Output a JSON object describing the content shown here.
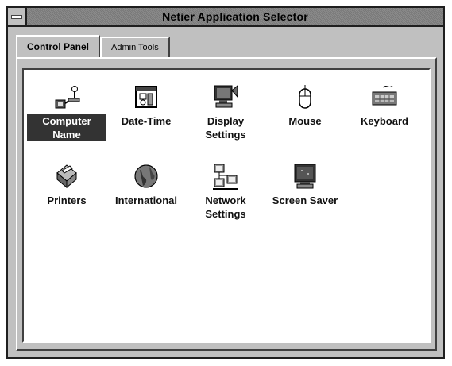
{
  "window": {
    "title": "Netier Application Selector"
  },
  "tabs": [
    {
      "label": "Control Panel",
      "active": true
    },
    {
      "label": "Admin Tools",
      "active": false
    }
  ],
  "items": [
    {
      "label": "Computer Name",
      "icon": "computer-name-icon",
      "selected": true
    },
    {
      "label": "Date-Time",
      "icon": "calendar-clock-icon"
    },
    {
      "label": "Display Settings",
      "icon": "monitor-icon"
    },
    {
      "label": "Mouse",
      "icon": "mouse-icon"
    },
    {
      "label": "Keyboard",
      "icon": "keyboard-icon"
    },
    {
      "label": "Printers",
      "icon": "printer-icon"
    },
    {
      "label": "International",
      "icon": "globe-icon"
    },
    {
      "label": "Network Settings",
      "icon": "network-icon"
    },
    {
      "label": "Screen Saver",
      "icon": "screen-saver-icon"
    }
  ]
}
